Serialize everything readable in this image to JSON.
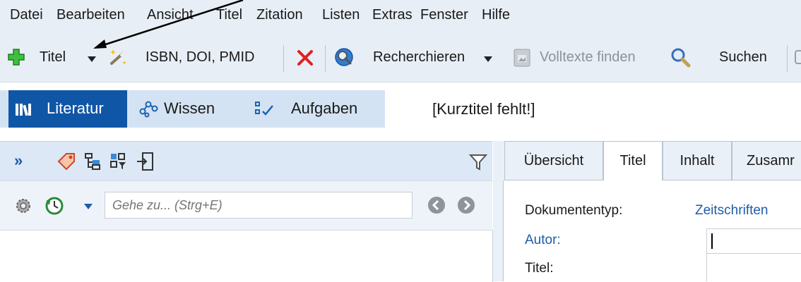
{
  "menu": [
    "Datei",
    "Bearbeiten",
    "Ansicht",
    "Titel",
    "Zitation",
    "Listen",
    "Extras",
    "Fenster",
    "Hilfe"
  ],
  "toolbar": {
    "titel_label": "Titel",
    "isbn_label": "ISBN, DOI, PMID",
    "recherchieren_label": "Recherchieren",
    "volltexte_label": "Volltexte finden",
    "suchen_label": "Suchen"
  },
  "nav": {
    "literatur": "Literatur",
    "wissen": "Wissen",
    "aufgaben": "Aufgaben"
  },
  "record_title": "[Kurztitel fehlt!]",
  "left_pane": {
    "goto_placeholder": "Gehe zu... (Strg+E)"
  },
  "tabs": [
    "Übersicht",
    "Titel",
    "Inhalt",
    "Zusamr"
  ],
  "fields": {
    "dokumententyp_label": "Dokumententyp:",
    "dokumententyp_value": "Zeitschriften",
    "autor_label": "Autor:",
    "titel_label": "Titel:"
  },
  "colors": {
    "accent": "#0f56a7",
    "link": "#1f5ca8",
    "toolbar_bg": "#e8eef6"
  }
}
